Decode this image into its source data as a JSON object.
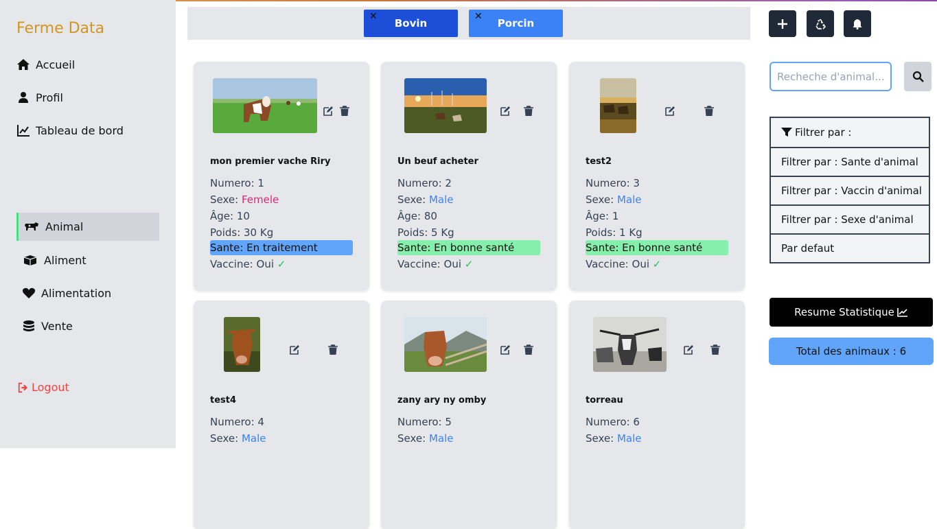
{
  "brand": "Ferme Data",
  "nav": {
    "accueil": "Accueil",
    "profil": "Profil",
    "tableau": "Tableau de bord",
    "animal": "Animal",
    "aliment": "Aliment",
    "alimentation": "Alimentation",
    "vente": "Vente",
    "logout": "Logout"
  },
  "categories": {
    "bovin": "Bovin",
    "porcin": "Porcin",
    "close": "✕"
  },
  "search": {
    "placeholder": "Recheche d'animal..."
  },
  "filters": {
    "title": "Filtrer par :",
    "sante": "Filtrer par : Sante d'animal",
    "vaccin": "Filtrer par : Vaccin d'animal",
    "sexe": "Filtrer par : Sexe d'animal",
    "defaut": "Par defaut"
  },
  "stats_label": "Resume Statistique",
  "total_label": "Total des animaux : 6",
  "labels": {
    "numero": "Numero: ",
    "sexe": "Sexe: ",
    "age": "Âge: ",
    "poids": "Poids: ",
    "sante": "Sante: ",
    "vaccine": "Vaccine: "
  },
  "animals": [
    {
      "name": "mon premier vache Riry",
      "numero": "1",
      "sexe": "Femele",
      "age": "10",
      "poids": "30 Kg",
      "sante": "En traitement",
      "vaccine": "Oui"
    },
    {
      "name": "Un beuf acheter",
      "numero": "2",
      "sexe": "Male",
      "age": "80",
      "poids": "5 Kg",
      "sante": "En bonne santé",
      "vaccine": "Oui"
    },
    {
      "name": "test2",
      "numero": "3",
      "sexe": "Male",
      "age": "1",
      "poids": "1 Kg",
      "sante": "En bonne santé",
      "vaccine": "Oui"
    },
    {
      "name": "test4",
      "numero": "4",
      "sexe": "Male"
    },
    {
      "name": "zany ary ny omby",
      "numero": "5",
      "sexe": "Male"
    },
    {
      "name": "torreau",
      "numero": "6",
      "sexe": "Male"
    }
  ],
  "colors": {
    "sante_traitement": "#60a5fa",
    "sante_bonne": "#86efac",
    "female": "#db2777",
    "male": "#3b82f6"
  }
}
